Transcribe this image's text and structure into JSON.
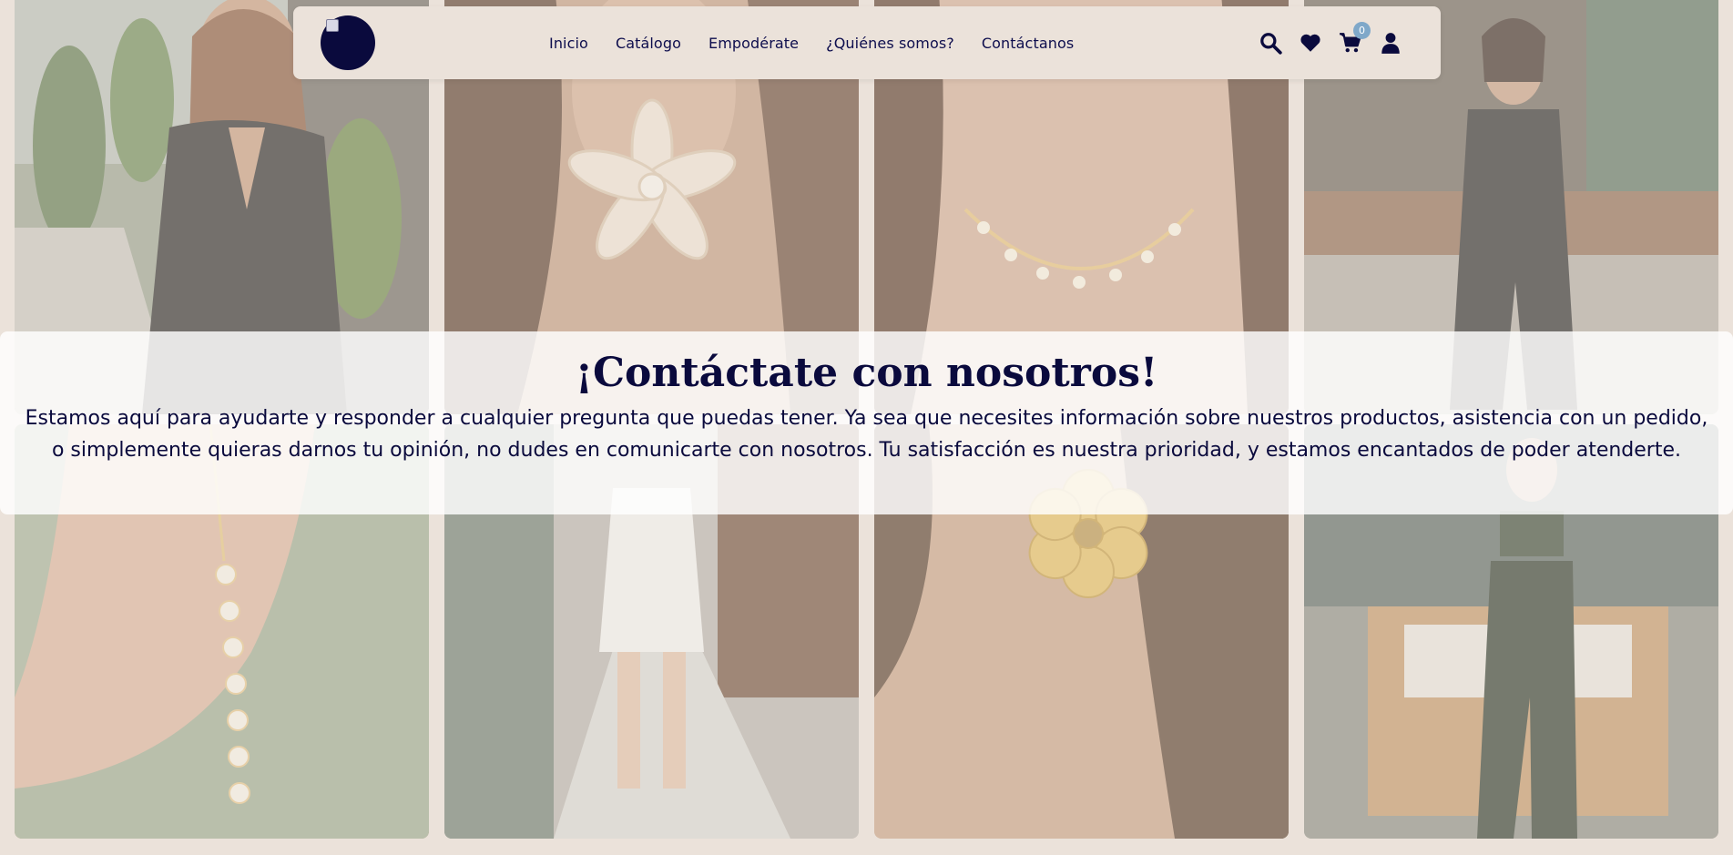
{
  "navbar": {
    "logo_alt": "Logo",
    "links": [
      "Inicio",
      "Catálogo",
      "Empodérate",
      "¿Quiénes somos?",
      "Contáctanos"
    ],
    "icons": [
      "search-icon",
      "heart-icon",
      "cart-icon",
      "user-icon"
    ],
    "cart_count": "0"
  },
  "banner": {
    "title": "¡Contáctate con nosotros!",
    "text": "Estamos aquí para ayudarte y responder a cualquier pregunta que puedas tener. Ya sea que necesites información sobre nuestros productos, asistencia con un pedido, o simplemente quieras darnos tu opinión, no dudes en comunicarte con nosotros. Tu satisfacción es nuestra prioridad, y estamos encantados de poder atenderte."
  },
  "gallery": {
    "photos": [
      "model-black-robe",
      "flower-pearl-earring",
      "daisy-necklace",
      "model-black-jumpsuit",
      "daisy-drop-necklace",
      "model-white-dress",
      "gold-flower-earring",
      "model-green-outfit"
    ]
  },
  "colors": {
    "background": "#ebe2da",
    "navy": "#0a0a3d",
    "badge": "#7fa8c9"
  }
}
